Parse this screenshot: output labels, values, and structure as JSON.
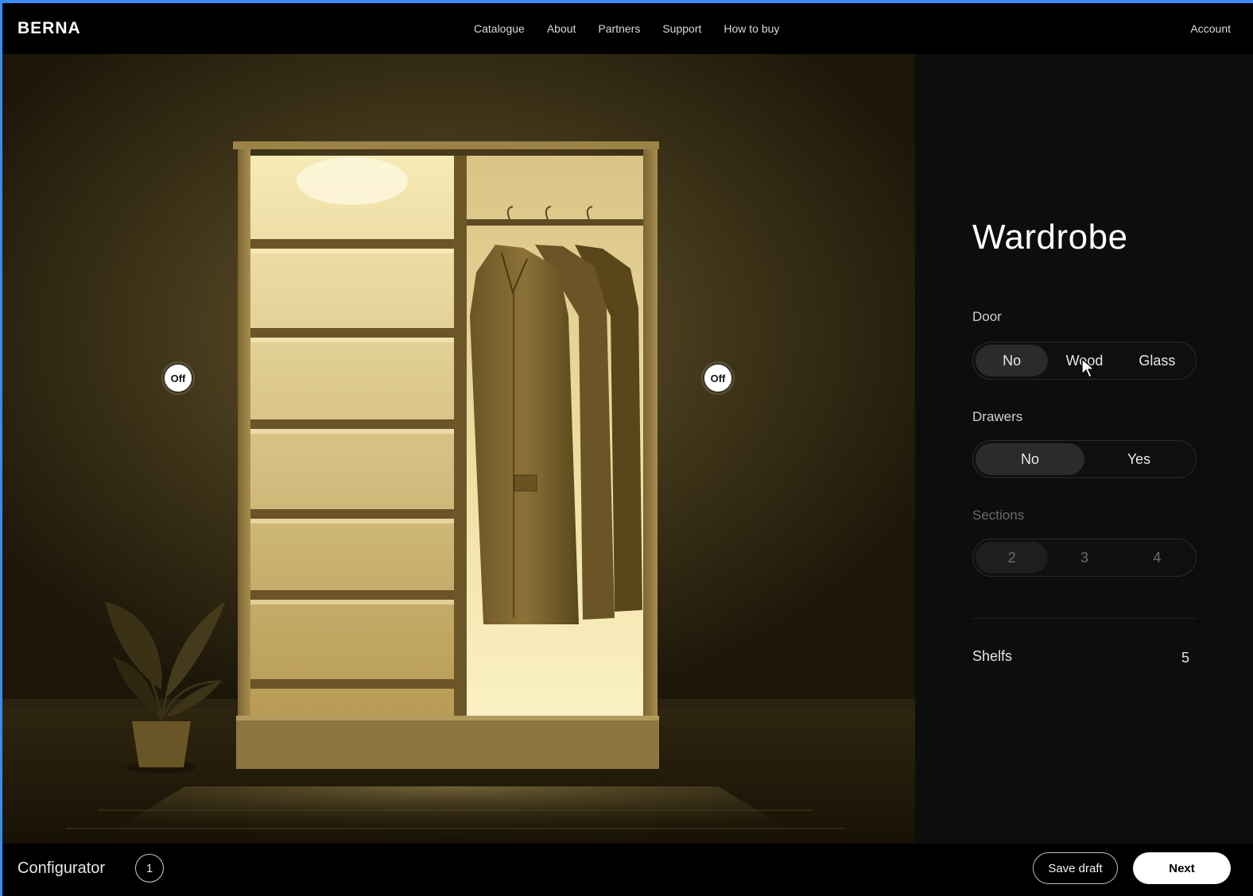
{
  "brand": {
    "name": "BERNA"
  },
  "nav": {
    "items": [
      {
        "label": "Catalogue"
      },
      {
        "label": "About"
      },
      {
        "label": "Partners"
      },
      {
        "label": "Support"
      },
      {
        "label": "How to buy"
      }
    ],
    "account_label": "Account"
  },
  "scene": {
    "light_left": {
      "label": "Off"
    },
    "light_right": {
      "label": "Off"
    }
  },
  "panel": {
    "title": "Wardrobe",
    "door": {
      "label": "Door",
      "options": [
        "No",
        "Wood",
        "Glass"
      ],
      "selected": "No"
    },
    "drawers": {
      "label": "Drawers",
      "options": [
        "No",
        "Yes"
      ],
      "selected": "No"
    },
    "sections": {
      "label": "Sections",
      "options": [
        "2",
        "3",
        "4"
      ],
      "selected": "2",
      "disabled": true
    },
    "shelfs": {
      "label": "Shelfs",
      "value": "5"
    }
  },
  "footer": {
    "title": "Configurator",
    "step": "1",
    "save_label": "Save draft",
    "next_label": "Next"
  },
  "colors": {
    "accent_frame": "#3b8cf0",
    "wood_light": "#f3e3a8",
    "wood_dark": "#5e4a22",
    "panel_bg": "#0d0d0d"
  }
}
